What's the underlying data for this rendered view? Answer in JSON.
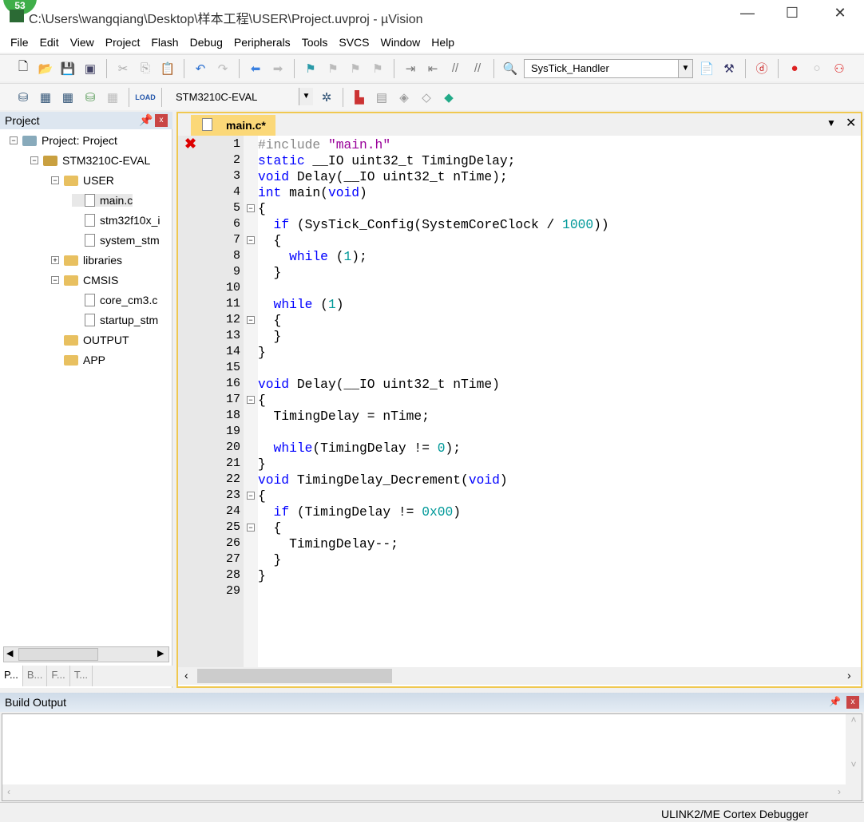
{
  "window": {
    "title": "C:\\Users\\wangqiang\\Desktop\\样本工程\\USER\\Project.uvproj - µVision",
    "badge": "53",
    "minimize": "—",
    "maximize": "☐",
    "close": "✕"
  },
  "menu": [
    "File",
    "Edit",
    "View",
    "Project",
    "Flash",
    "Debug",
    "Peripherals",
    "Tools",
    "SVCS",
    "Window",
    "Help"
  ],
  "toolbar1": {
    "function_combo": "SysTick_Handler"
  },
  "toolbar2": {
    "target_combo": "STM3210C-EVAL"
  },
  "project_panel": {
    "title": "Project",
    "tree": [
      {
        "label": "Project: Project",
        "depth": 0,
        "type": "root",
        "fold": "−"
      },
      {
        "label": "STM3210C-EVAL",
        "depth": 1,
        "type": "target",
        "fold": "−"
      },
      {
        "label": "USER",
        "depth": 2,
        "type": "folder",
        "fold": "−"
      },
      {
        "label": "main.c",
        "depth": 3,
        "type": "file"
      },
      {
        "label": "stm32f10x_i",
        "depth": 3,
        "type": "file"
      },
      {
        "label": "system_stm",
        "depth": 3,
        "type": "file"
      },
      {
        "label": "libraries",
        "depth": 2,
        "type": "folder",
        "fold": "+"
      },
      {
        "label": "CMSIS",
        "depth": 2,
        "type": "folder",
        "fold": "−"
      },
      {
        "label": "core_cm3.c",
        "depth": 3,
        "type": "file"
      },
      {
        "label": "startup_stm",
        "depth": 3,
        "type": "file"
      },
      {
        "label": "OUTPUT",
        "depth": 2,
        "type": "folder"
      },
      {
        "label": "APP",
        "depth": 2,
        "type": "folder"
      }
    ],
    "tabs": [
      "P...",
      "B...",
      "F...",
      "T..."
    ]
  },
  "editor": {
    "tab": "main.c*",
    "code": [
      [
        [
          "#include ",
          "p"
        ],
        [
          "\"main.h\"",
          "s"
        ]
      ],
      [
        [
          "static",
          "k"
        ],
        [
          " __IO uint32_t TimingDelay;",
          ""
        ]
      ],
      [
        [
          "void",
          "k"
        ],
        [
          " Delay(__IO uint32_t nTime);",
          ""
        ]
      ],
      [
        [
          "int",
          "k"
        ],
        [
          " main(",
          ""
        ],
        [
          "void",
          "k"
        ],
        [
          ")",
          ""
        ]
      ],
      [
        [
          "{",
          ""
        ]
      ],
      [
        [
          "  ",
          ""
        ],
        [
          "if",
          "k"
        ],
        [
          " (SysTick_Config(SystemCoreClock / ",
          ""
        ],
        [
          "1000",
          "n"
        ],
        [
          "))",
          ""
        ]
      ],
      [
        [
          "  {",
          ""
        ]
      ],
      [
        [
          "    ",
          ""
        ],
        [
          "while",
          "k"
        ],
        [
          " (",
          ""
        ],
        [
          "1",
          "n"
        ],
        [
          ");",
          ""
        ]
      ],
      [
        [
          "  }",
          ""
        ]
      ],
      [
        [
          "",
          ""
        ]
      ],
      [
        [
          "  ",
          ""
        ],
        [
          "while",
          "k"
        ],
        [
          " (",
          ""
        ],
        [
          "1",
          "n"
        ],
        [
          ")",
          ""
        ]
      ],
      [
        [
          "  {",
          ""
        ]
      ],
      [
        [
          "  }",
          ""
        ]
      ],
      [
        [
          "}",
          ""
        ]
      ],
      [
        [
          "",
          ""
        ]
      ],
      [
        [
          "void",
          "k"
        ],
        [
          " Delay(__IO uint32_t nTime)",
          ""
        ]
      ],
      [
        [
          "{",
          ""
        ]
      ],
      [
        [
          "  TimingDelay = nTime;",
          ""
        ]
      ],
      [
        [
          "",
          ""
        ]
      ],
      [
        [
          "  ",
          ""
        ],
        [
          "while",
          "k"
        ],
        [
          "(TimingDelay != ",
          ""
        ],
        [
          "0",
          "n"
        ],
        [
          ");",
          ""
        ]
      ],
      [
        [
          "}",
          ""
        ]
      ],
      [
        [
          "void",
          "k"
        ],
        [
          " TimingDelay_Decrement(",
          ""
        ],
        [
          "void",
          "k"
        ],
        [
          ")",
          ""
        ]
      ],
      [
        [
          "{",
          ""
        ]
      ],
      [
        [
          "  ",
          ""
        ],
        [
          "if",
          "k"
        ],
        [
          " (TimingDelay != ",
          ""
        ],
        [
          "0x00",
          "n"
        ],
        [
          ")",
          ""
        ]
      ],
      [
        [
          "  {",
          ""
        ]
      ],
      [
        [
          "    TimingDelay--;",
          ""
        ]
      ],
      [
        [
          "  }",
          ""
        ]
      ],
      [
        [
          "}",
          ""
        ]
      ],
      [
        [
          "",
          ""
        ]
      ]
    ],
    "folds": {
      "5": "−",
      "7": "−",
      "12": "−",
      "17": "−",
      "23": "−",
      "25": "−"
    },
    "error_line": 1
  },
  "build_output": {
    "title": "Build Output"
  },
  "status": {
    "debugger": "ULINK2/ME Cortex Debugger"
  }
}
